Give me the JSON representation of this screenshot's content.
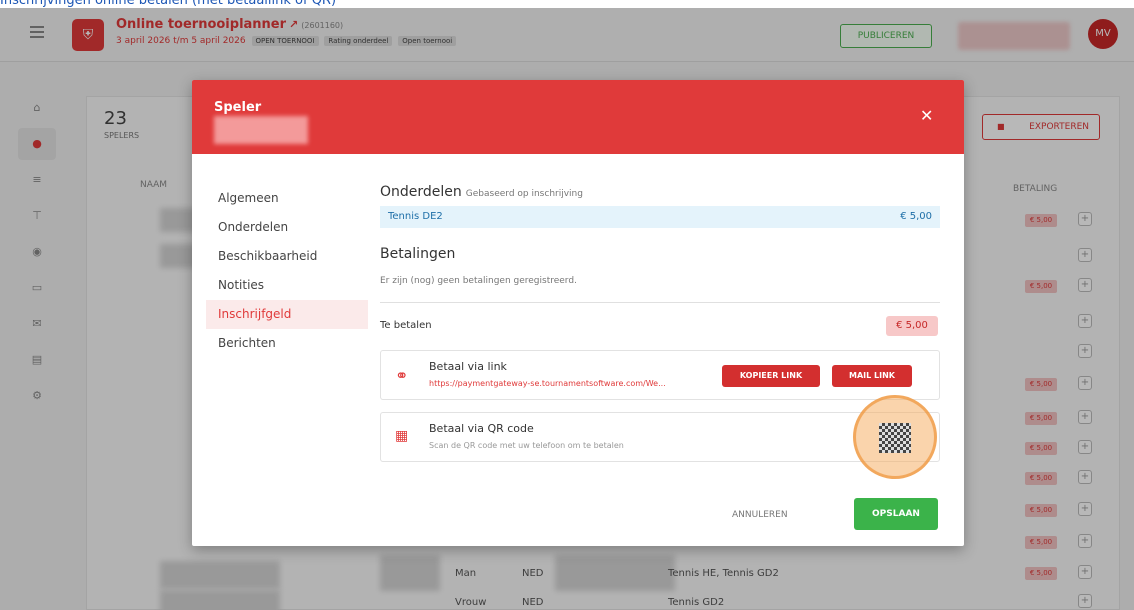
{
  "banner": {
    "text": "Inschrijvingen online betalen (met betaallink of QR)"
  },
  "topbar": {
    "app_title": "Online toernooiplanner",
    "tournament_id": "(2601160)",
    "dates": "3 april 2026 t/m 5 april 2026",
    "tags": [
      "OPEN TOERNOOI",
      "Rating onderdeel",
      "Open toernooi"
    ],
    "publish_label": "PUBLICEREN",
    "avatar_initials": "MV"
  },
  "players": {
    "count": "23",
    "count_label": "SPELERS",
    "export_label": "EXPORTEREN",
    "col_naam": "NAAM",
    "col_betaling": "BETALING",
    "badge_amount": "€ 5,00",
    "rows": [
      {
        "gender": "Man",
        "country": "NED",
        "events": "Tennis HE, Tennis GD2",
        "has_badge": true
      },
      {
        "gender": "Vrouw",
        "country": "NED",
        "events": "Tennis GD2",
        "has_badge": false
      }
    ]
  },
  "modal": {
    "title": "Speler",
    "menu": [
      "Algemeen",
      "Onderdelen",
      "Beschikbaarheid",
      "Notities",
      "Inschrijfgeld",
      "Berichten"
    ],
    "active_menu": "Inschrijfgeld",
    "onderdelen_title": "Onderdelen",
    "onderdelen_sub": "Gebaseerd op inschrijving",
    "onderdeel_name": "Tennis DE2",
    "onderdeel_price": "€ 5,00",
    "betalingen_title": "Betalingen",
    "no_payments": "Er zijn (nog) geen betalingen geregistreerd.",
    "te_betalen_label": "Te betalen",
    "te_betalen_amount": "€ 5,00",
    "link": {
      "title": "Betaal via link",
      "url": "https://paymentgateway-se.tournamentsoftware.com/We...",
      "copy_label": "KOPIEER LINK",
      "mail_label": "MAIL LINK"
    },
    "qr": {
      "title": "Betaal via QR code",
      "subtitle": "Scan de QR code met uw telefoon om te betalen"
    },
    "cancel_label": "ANNULEREN",
    "save_label": "OPSLAAN"
  },
  "colors": {
    "accent": "#e03a3a",
    "success": "#3bb34a",
    "highlight": "#f0963c",
    "info": "#e4f3fb"
  }
}
